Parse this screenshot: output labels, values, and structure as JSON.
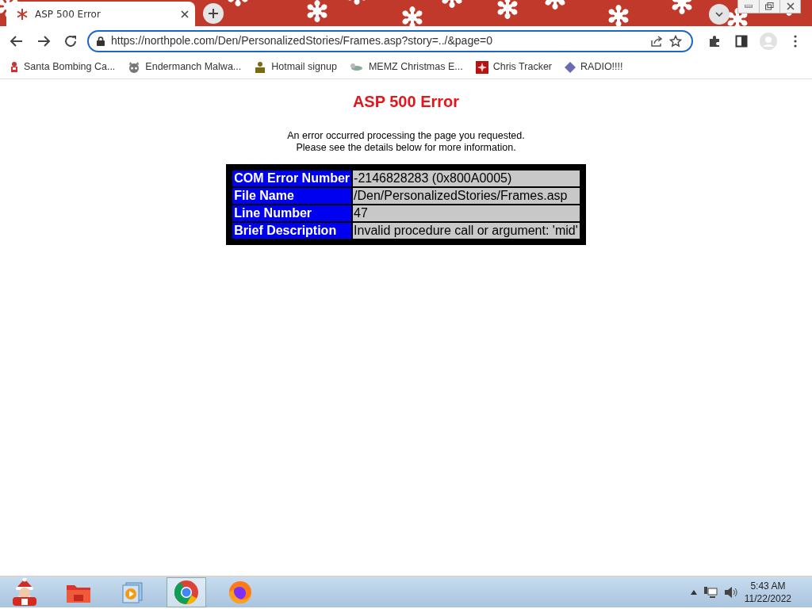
{
  "browser": {
    "tabs": [
      {
        "title": "ASP 500 Error",
        "selected": true
      }
    ],
    "url": "https://northpole.com/Den/PersonalizedStories/Frames.asp?story=../&page=0",
    "bookmarks": [
      {
        "label": "Santa Bombing Ca..."
      },
      {
        "label": "Endermanch Malwa..."
      },
      {
        "label": "Hotmail signup"
      },
      {
        "label": "MEMZ Christmas E..."
      },
      {
        "label": "Chris Tracker"
      },
      {
        "label": "RADIO!!!!"
      }
    ]
  },
  "page": {
    "title": "ASP 500 Error",
    "message_lines": [
      "An error occurred processing the page you requested.",
      "Please see the details below for more information."
    ],
    "details": [
      {
        "label": "COM Error Number",
        "value": "-2146828283 (0x800A0005)"
      },
      {
        "label": "File Name",
        "value": "/Den/PersonalizedStories/Frames.asp"
      },
      {
        "label": "Line Number",
        "value": "47"
      },
      {
        "label": "Brief Description",
        "value": "Invalid procedure call or argument: 'mid'"
      }
    ]
  },
  "taskbar": {
    "apps": [
      {
        "kind": "folder",
        "selected": false
      },
      {
        "kind": "media",
        "selected": false
      },
      {
        "kind": "chrome",
        "selected": true
      },
      {
        "kind": "firefox",
        "selected": false
      }
    ],
    "clock": {
      "time": "5:43 AM",
      "date": "11/22/2022"
    }
  }
}
